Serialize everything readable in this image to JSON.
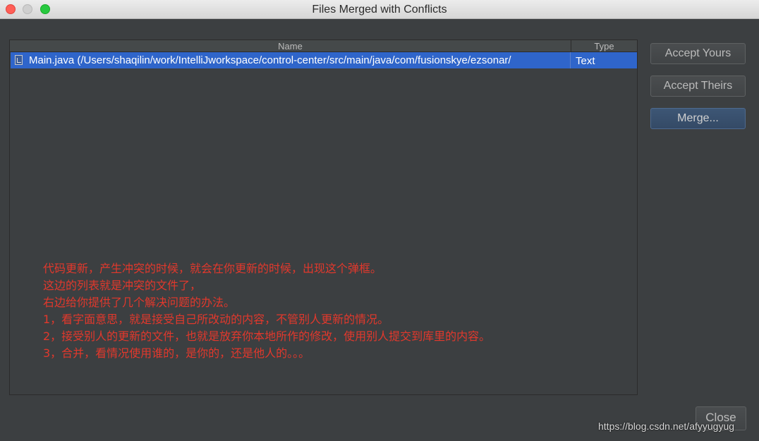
{
  "window": {
    "title": "Files Merged with Conflicts"
  },
  "table": {
    "columns": [
      "Name",
      "Type"
    ],
    "rows": [
      {
        "name": "Main.java (/Users/shaqilin/work/IntelliJworkspace/control-center/src/main/java/com/fusionskye/ezsonar/",
        "type": "Text",
        "icon": "java-file-icon"
      }
    ]
  },
  "buttons": {
    "accept_yours": "Accept Yours",
    "accept_theirs": "Accept Theirs",
    "merge": "Merge...",
    "close": "Close"
  },
  "annotation": {
    "color": "#e2382c",
    "lines": [
      "代码更新，产生冲突的时候，就会在你更新的时候，出现这个弹框。",
      "这边的列表就是冲突的文件了，",
      "右边给你提供了几个解决问题的办法。",
      "1，看字面意思，就是接受自己所改动的内容，不管别人更新的情况。",
      "2，接受别人的更新的文件，也就是放弃你本地所作的修改，使用别人提交到库里的内容。",
      "3，合并，看情况使用谁的，是你的，还是他人的。。。"
    ]
  },
  "watermark": "https://blog.csdn.net/afyyugyug",
  "colors": {
    "selection": "#2f65ca",
    "background": "#3c3f41"
  }
}
